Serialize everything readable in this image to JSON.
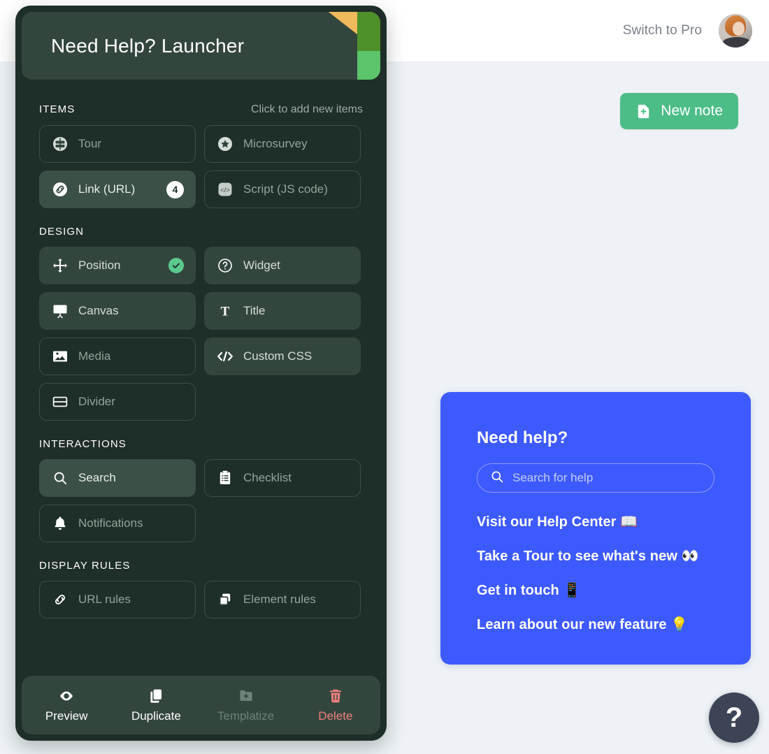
{
  "topbar": {
    "switch_to_pro": "Switch to Pro",
    "avatar_name": "user-avatar"
  },
  "actions": {
    "new_note": "New note"
  },
  "launcher": {
    "title": "Need Help? Launcher",
    "sections": [
      {
        "title": "ITEMS",
        "hint": "Click to add new items",
        "items": [
          {
            "label": "Tour",
            "icon": "signpost-icon",
            "style": "outline"
          },
          {
            "label": "Microsurvey",
            "icon": "star-icon",
            "style": "outline"
          },
          {
            "label": "Link (URL)",
            "icon": "link-icon",
            "style": "active",
            "badge": "4"
          },
          {
            "label": "Script (JS code)",
            "icon": "code-icon",
            "style": "outline"
          }
        ]
      },
      {
        "title": "DESIGN",
        "hint": "",
        "items": [
          {
            "label": "Position",
            "icon": "move-icon",
            "style": "filled",
            "check": true
          },
          {
            "label": "Widget",
            "icon": "question-icon",
            "style": "filled"
          },
          {
            "label": "Canvas",
            "icon": "presentation-icon",
            "style": "filled"
          },
          {
            "label": "Title",
            "icon": "text-icon",
            "style": "filled"
          },
          {
            "label": "Media",
            "icon": "image-icon",
            "style": "outline"
          },
          {
            "label": "Custom CSS",
            "icon": "code-brackets-icon",
            "style": "filled"
          },
          {
            "label": "Divider",
            "icon": "divider-icon",
            "style": "outline"
          }
        ]
      },
      {
        "title": "INTERACTIONS",
        "hint": "",
        "items": [
          {
            "label": "Search",
            "icon": "search-icon",
            "style": "active"
          },
          {
            "label": "Checklist",
            "icon": "clipboard-icon",
            "style": "outline"
          },
          {
            "label": "Notifications",
            "icon": "bell-icon",
            "style": "outline"
          }
        ]
      },
      {
        "title": "DISPLAY RULES",
        "hint": "",
        "items": [
          {
            "label": "URL rules",
            "icon": "link-chain-icon",
            "style": "outline"
          },
          {
            "label": "Element rules",
            "icon": "layers-icon",
            "style": "outline"
          }
        ]
      }
    ],
    "footer": [
      {
        "label": "Preview",
        "icon": "eye-icon",
        "state": "normal"
      },
      {
        "label": "Duplicate",
        "icon": "copy-icon",
        "state": "normal"
      },
      {
        "label": "Templatize",
        "icon": "folder-add-icon",
        "state": "disabled"
      },
      {
        "label": "Delete",
        "icon": "trash-icon",
        "state": "danger"
      }
    ]
  },
  "help_widget": {
    "heading": "Need help?",
    "search_placeholder": "Search for help",
    "links": [
      "Visit our Help Center 📖",
      "Take a Tour to see what's new 👀",
      "Get in touch 📱",
      "Learn about our new feature 💡"
    ]
  },
  "fab": {
    "label": "?"
  },
  "colors": {
    "panel_bg": "#1e2e28",
    "card_filled": "#33463e",
    "card_active": "#3b5047",
    "accent_green": "#4cbd87",
    "check_green": "#5cc98d",
    "widget_blue": "#3d5afe",
    "danger_red": "#f2807f",
    "page_bg": "#eef2f6",
    "deco_orange": "#f0b95c",
    "deco_dark_green": "#4e9029",
    "deco_light_green": "#5cc46a"
  }
}
